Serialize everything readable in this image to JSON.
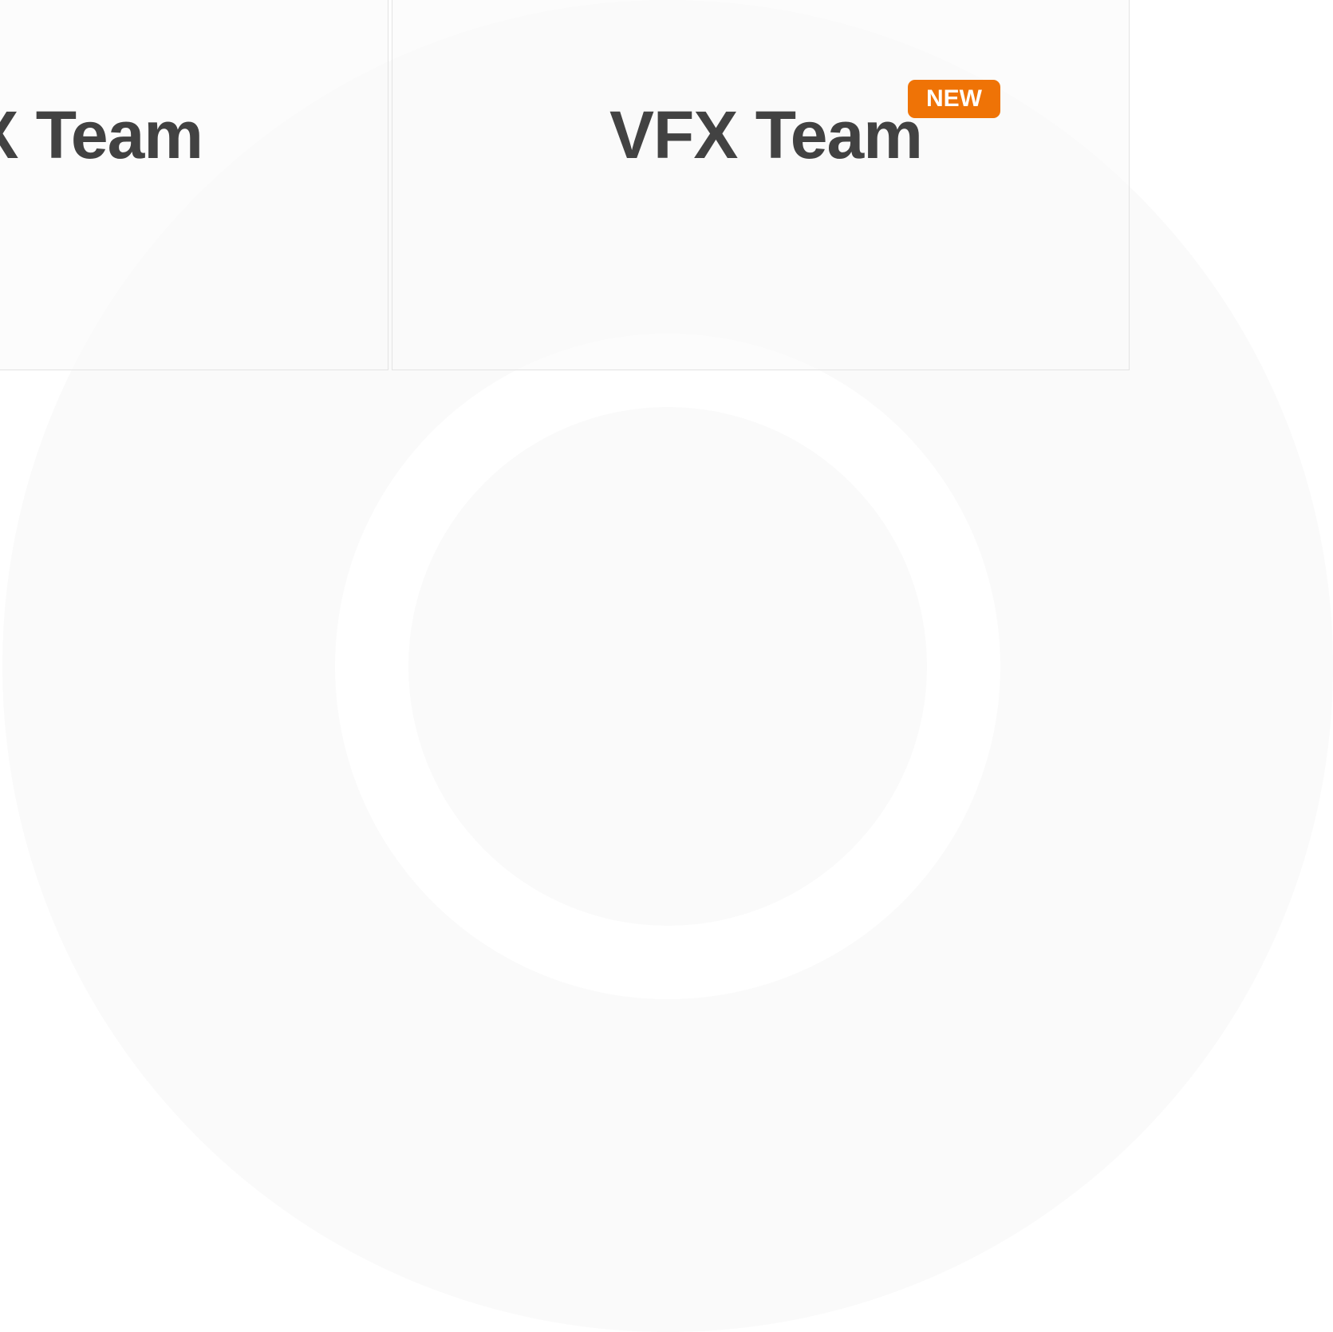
{
  "cards": [
    {
      "title": "VFX Team"
    },
    {
      "title": "VFX Team",
      "badge": "NEW"
    }
  ],
  "colors": {
    "title_text": "#424242",
    "badge_background": "#ef7306",
    "badge_text": "#ffffff",
    "card_border": "#e3e3e3",
    "backdrop_ring": "#fafafa"
  }
}
